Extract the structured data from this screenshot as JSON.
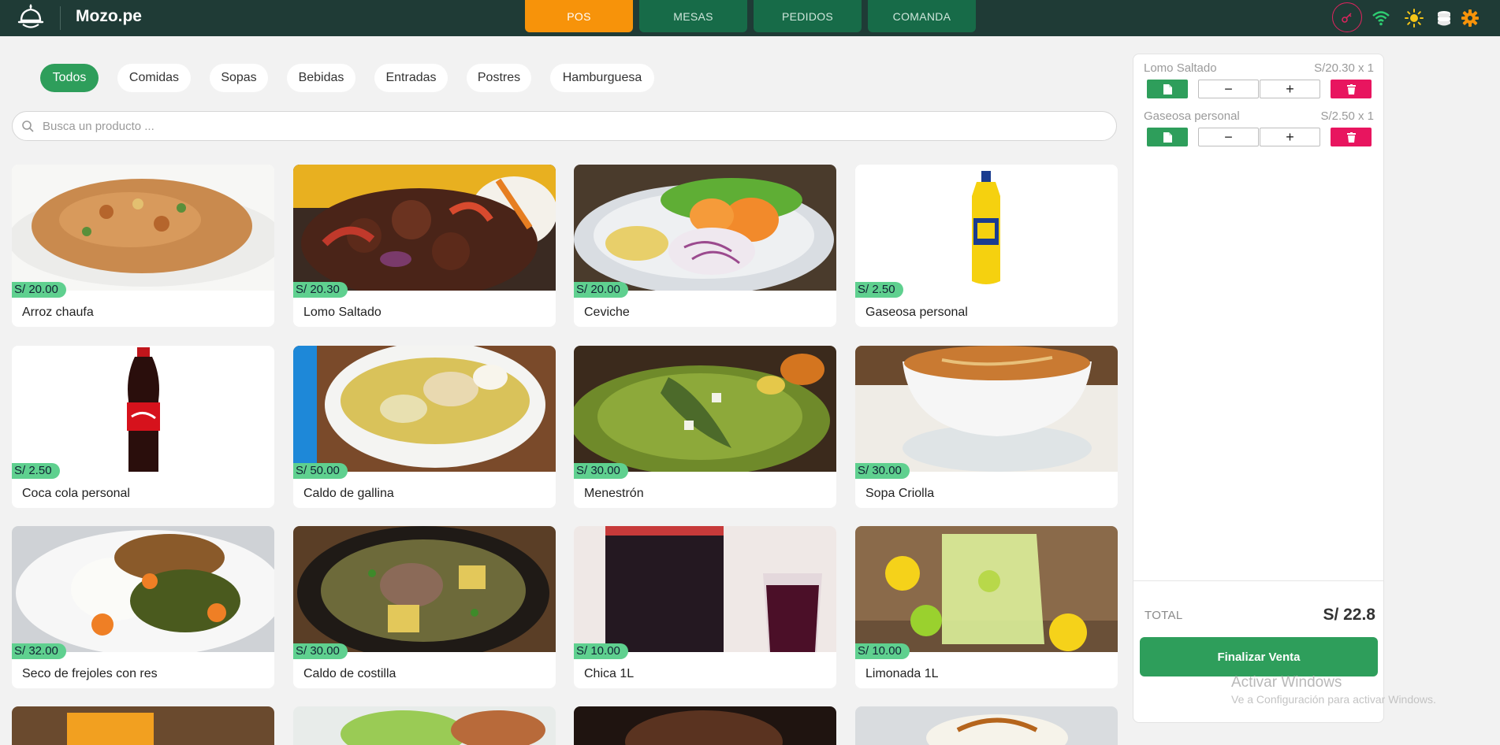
{
  "app": {
    "brand": "Mozo.pe"
  },
  "nav": [
    {
      "label": "POS",
      "active": true
    },
    {
      "label": "MESAS",
      "active": false
    },
    {
      "label": "PEDIDOS",
      "active": false
    },
    {
      "label": "COMANDA",
      "active": false
    }
  ],
  "top_icons": [
    "key-icon",
    "wifi-icon",
    "sun-icon",
    "coins-icon",
    "gear-icon"
  ],
  "categories": [
    {
      "label": "Todos",
      "active": true
    },
    {
      "label": "Comidas",
      "active": false
    },
    {
      "label": "Sopas",
      "active": false
    },
    {
      "label": "Bebidas",
      "active": false
    },
    {
      "label": "Entradas",
      "active": false
    },
    {
      "label": "Postres",
      "active": false
    },
    {
      "label": "Hamburguesa",
      "active": false
    }
  ],
  "search": {
    "placeholder": "Busca un producto ..."
  },
  "products": [
    {
      "name": "Arroz chaufa",
      "price": "S/ 20.00"
    },
    {
      "name": "Lomo Saltado",
      "price": "S/ 20.30"
    },
    {
      "name": "Ceviche",
      "price": "S/ 20.00"
    },
    {
      "name": "Gaseosa personal",
      "price": "S/ 2.50"
    },
    {
      "name": "Coca cola personal",
      "price": "S/ 2.50"
    },
    {
      "name": "Caldo de gallina",
      "price": "S/ 50.00"
    },
    {
      "name": "Menestrón",
      "price": "S/ 30.00"
    },
    {
      "name": "Sopa Criolla",
      "price": "S/ 30.00"
    },
    {
      "name": "Seco de frejoles con res",
      "price": "S/ 32.00"
    },
    {
      "name": "Caldo de costilla",
      "price": "S/ 30.00"
    },
    {
      "name": "Chica 1L",
      "price": "S/ 10.00"
    },
    {
      "name": "Limonada 1L",
      "price": "S/ 10.00"
    }
  ],
  "order": {
    "items": [
      {
        "name": "Lomo Saltado",
        "price_qty": "S/20.30 x 1"
      },
      {
        "name": "Gaseosa personal",
        "price_qty": "S/2.50 x 1"
      }
    ],
    "minus_label": "−",
    "plus_label": "+",
    "total_label": "TOTAL",
    "total_value": "S/ 22.8",
    "finalize_label": "Finalizar Venta"
  },
  "watermark": {
    "title": "Activar Windows",
    "subtitle": "Ve a Configuración para activar Windows."
  },
  "colors": {
    "topbar": "#1f3b36",
    "nav_active": "#f7930a",
    "nav_inactive": "#176b48",
    "green": "#2e9e5b",
    "price_badge": "#5fd08f",
    "delete": "#e8155f"
  }
}
